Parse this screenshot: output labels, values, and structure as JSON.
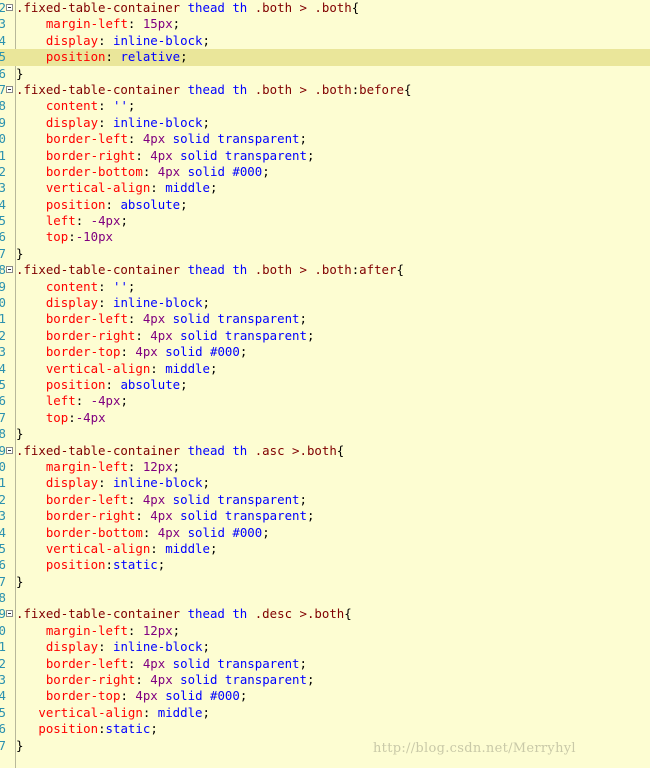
{
  "editor": {
    "lines": [
      {
        "ln": "2",
        "fold": true,
        "tokens": [
          [
            "sel",
            ".fixed-table-container "
          ],
          [
            "kw",
            "thead th"
          ],
          [
            "sel",
            " .both > .both"
          ],
          [
            "pun",
            "{"
          ]
        ]
      },
      {
        "ln": "3",
        "tokens": [
          [
            "pun",
            "    "
          ],
          [
            "prop",
            "margin-left"
          ],
          [
            "pun",
            ": "
          ],
          [
            "num",
            "15px"
          ],
          [
            "pun",
            ";"
          ]
        ]
      },
      {
        "ln": "4",
        "tokens": [
          [
            "pun",
            "    "
          ],
          [
            "prop",
            "display"
          ],
          [
            "pun",
            ": "
          ],
          [
            "val",
            "inline-block"
          ],
          [
            "pun",
            ";"
          ]
        ]
      },
      {
        "ln": "5",
        "hl": true,
        "tokens": [
          [
            "pun",
            "    "
          ],
          [
            "prop",
            "position"
          ],
          [
            "pun",
            ": "
          ],
          [
            "val",
            "relative"
          ],
          [
            "pun",
            ";"
          ]
        ]
      },
      {
        "ln": "6",
        "tokens": [
          [
            "pun",
            "}"
          ]
        ]
      },
      {
        "ln": "7",
        "fold": true,
        "tokens": [
          [
            "sel",
            ".fixed-table-container "
          ],
          [
            "kw",
            "thead th"
          ],
          [
            "sel",
            " .both > .both"
          ],
          [
            "pun",
            ":"
          ],
          [
            "sel",
            "before"
          ],
          [
            "pun",
            "{"
          ]
        ]
      },
      {
        "ln": "8",
        "tokens": [
          [
            "pun",
            "    "
          ],
          [
            "prop",
            "content"
          ],
          [
            "pun",
            ": "
          ],
          [
            "val",
            "''"
          ],
          [
            "pun",
            ";"
          ]
        ]
      },
      {
        "ln": "9",
        "tokens": [
          [
            "pun",
            "    "
          ],
          [
            "prop",
            "display"
          ],
          [
            "pun",
            ": "
          ],
          [
            "val",
            "inline-block"
          ],
          [
            "pun",
            ";"
          ]
        ]
      },
      {
        "ln": "0",
        "tokens": [
          [
            "pun",
            "    "
          ],
          [
            "prop",
            "border-left"
          ],
          [
            "pun",
            ": "
          ],
          [
            "num",
            "4px"
          ],
          [
            "val",
            " solid transparent"
          ],
          [
            "pun",
            ";"
          ]
        ]
      },
      {
        "ln": "1",
        "tokens": [
          [
            "pun",
            "    "
          ],
          [
            "prop",
            "border-right"
          ],
          [
            "pun",
            ": "
          ],
          [
            "num",
            "4px"
          ],
          [
            "val",
            " solid transparent"
          ],
          [
            "pun",
            ";"
          ]
        ]
      },
      {
        "ln": "2",
        "tokens": [
          [
            "pun",
            "    "
          ],
          [
            "prop",
            "border-bottom"
          ],
          [
            "pun",
            ": "
          ],
          [
            "num",
            "4px"
          ],
          [
            "val",
            " solid #000"
          ],
          [
            "pun",
            ";"
          ]
        ]
      },
      {
        "ln": "3",
        "tokens": [
          [
            "pun",
            "    "
          ],
          [
            "prop",
            "vertical-align"
          ],
          [
            "pun",
            ": "
          ],
          [
            "val",
            "middle"
          ],
          [
            "pun",
            ";"
          ]
        ]
      },
      {
        "ln": "4",
        "tokens": [
          [
            "pun",
            "    "
          ],
          [
            "prop",
            "position"
          ],
          [
            "pun",
            ": "
          ],
          [
            "val",
            "absolute"
          ],
          [
            "pun",
            ";"
          ]
        ]
      },
      {
        "ln": "5",
        "tokens": [
          [
            "pun",
            "    "
          ],
          [
            "prop",
            "left"
          ],
          [
            "pun",
            ": "
          ],
          [
            "num",
            "-4px"
          ],
          [
            "pun",
            ";"
          ]
        ]
      },
      {
        "ln": "6",
        "tokens": [
          [
            "pun",
            "    "
          ],
          [
            "prop",
            "top"
          ],
          [
            "pun",
            ":"
          ],
          [
            "num",
            "-10px"
          ]
        ]
      },
      {
        "ln": "7",
        "tokens": [
          [
            "pun",
            "}"
          ]
        ]
      },
      {
        "ln": "8",
        "fold": true,
        "tokens": [
          [
            "sel",
            ".fixed-table-container "
          ],
          [
            "kw",
            "thead th"
          ],
          [
            "sel",
            " .both > .both"
          ],
          [
            "pun",
            ":"
          ],
          [
            "sel",
            "after"
          ],
          [
            "pun",
            "{"
          ]
        ]
      },
      {
        "ln": "9",
        "tokens": [
          [
            "pun",
            "    "
          ],
          [
            "prop",
            "content"
          ],
          [
            "pun",
            ": "
          ],
          [
            "val",
            "''"
          ],
          [
            "pun",
            ";"
          ]
        ]
      },
      {
        "ln": "0",
        "tokens": [
          [
            "pun",
            "    "
          ],
          [
            "prop",
            "display"
          ],
          [
            "pun",
            ": "
          ],
          [
            "val",
            "inline-block"
          ],
          [
            "pun",
            ";"
          ]
        ]
      },
      {
        "ln": "1",
        "tokens": [
          [
            "pun",
            "    "
          ],
          [
            "prop",
            "border-left"
          ],
          [
            "pun",
            ": "
          ],
          [
            "num",
            "4px"
          ],
          [
            "val",
            " solid transparent"
          ],
          [
            "pun",
            ";"
          ]
        ]
      },
      {
        "ln": "2",
        "tokens": [
          [
            "pun",
            "    "
          ],
          [
            "prop",
            "border-right"
          ],
          [
            "pun",
            ": "
          ],
          [
            "num",
            "4px"
          ],
          [
            "val",
            " solid transparent"
          ],
          [
            "pun",
            ";"
          ]
        ]
      },
      {
        "ln": "3",
        "tokens": [
          [
            "pun",
            "    "
          ],
          [
            "prop",
            "border-top"
          ],
          [
            "pun",
            ": "
          ],
          [
            "num",
            "4px"
          ],
          [
            "val",
            " solid #000"
          ],
          [
            "pun",
            ";"
          ]
        ]
      },
      {
        "ln": "4",
        "tokens": [
          [
            "pun",
            "    "
          ],
          [
            "prop",
            "vertical-align"
          ],
          [
            "pun",
            ": "
          ],
          [
            "val",
            "middle"
          ],
          [
            "pun",
            ";"
          ]
        ]
      },
      {
        "ln": "5",
        "tokens": [
          [
            "pun",
            "    "
          ],
          [
            "prop",
            "position"
          ],
          [
            "pun",
            ": "
          ],
          [
            "val",
            "absolute"
          ],
          [
            "pun",
            ";"
          ]
        ]
      },
      {
        "ln": "6",
        "tokens": [
          [
            "pun",
            "    "
          ],
          [
            "prop",
            "left"
          ],
          [
            "pun",
            ": "
          ],
          [
            "num",
            "-4px"
          ],
          [
            "pun",
            ";"
          ]
        ]
      },
      {
        "ln": "7",
        "tokens": [
          [
            "pun",
            "    "
          ],
          [
            "prop",
            "top"
          ],
          [
            "pun",
            ":"
          ],
          [
            "num",
            "-4px"
          ]
        ]
      },
      {
        "ln": "8",
        "tokens": [
          [
            "pun",
            "}"
          ]
        ]
      },
      {
        "ln": "9",
        "fold": true,
        "tokens": [
          [
            "sel",
            ".fixed-table-container "
          ],
          [
            "kw",
            "thead th"
          ],
          [
            "sel",
            " .asc >.both"
          ],
          [
            "pun",
            "{"
          ]
        ]
      },
      {
        "ln": "0",
        "tokens": [
          [
            "pun",
            "    "
          ],
          [
            "prop",
            "margin-left"
          ],
          [
            "pun",
            ": "
          ],
          [
            "num",
            "12px"
          ],
          [
            "pun",
            ";"
          ]
        ]
      },
      {
        "ln": "1",
        "tokens": [
          [
            "pun",
            "    "
          ],
          [
            "prop",
            "display"
          ],
          [
            "pun",
            ": "
          ],
          [
            "val",
            "inline-block"
          ],
          [
            "pun",
            ";"
          ]
        ]
      },
      {
        "ln": "2",
        "tokens": [
          [
            "pun",
            "    "
          ],
          [
            "prop",
            "border-left"
          ],
          [
            "pun",
            ": "
          ],
          [
            "num",
            "4px"
          ],
          [
            "val",
            " solid transparent"
          ],
          [
            "pun",
            ";"
          ]
        ]
      },
      {
        "ln": "3",
        "tokens": [
          [
            "pun",
            "    "
          ],
          [
            "prop",
            "border-right"
          ],
          [
            "pun",
            ": "
          ],
          [
            "num",
            "4px"
          ],
          [
            "val",
            " solid transparent"
          ],
          [
            "pun",
            ";"
          ]
        ]
      },
      {
        "ln": "4",
        "tokens": [
          [
            "pun",
            "    "
          ],
          [
            "prop",
            "border-bottom"
          ],
          [
            "pun",
            ": "
          ],
          [
            "num",
            "4px"
          ],
          [
            "val",
            " solid #000"
          ],
          [
            "pun",
            ";"
          ]
        ]
      },
      {
        "ln": "5",
        "tokens": [
          [
            "pun",
            "    "
          ],
          [
            "prop",
            "vertical-align"
          ],
          [
            "pun",
            ": "
          ],
          [
            "val",
            "middle"
          ],
          [
            "pun",
            ";"
          ]
        ]
      },
      {
        "ln": "6",
        "tokens": [
          [
            "pun",
            "    "
          ],
          [
            "prop",
            "position"
          ],
          [
            "pun",
            ":"
          ],
          [
            "val",
            "static"
          ],
          [
            "pun",
            ";"
          ]
        ]
      },
      {
        "ln": "7",
        "tokens": [
          [
            "pun",
            "}"
          ]
        ]
      },
      {
        "ln": "8",
        "tokens": []
      },
      {
        "ln": "9",
        "fold": true,
        "tokens": [
          [
            "sel",
            ".fixed-table-container "
          ],
          [
            "kw",
            "thead th"
          ],
          [
            "sel",
            " .desc >.both"
          ],
          [
            "pun",
            "{"
          ]
        ]
      },
      {
        "ln": "0",
        "tokens": [
          [
            "pun",
            "    "
          ],
          [
            "prop",
            "margin-left"
          ],
          [
            "pun",
            ": "
          ],
          [
            "num",
            "12px"
          ],
          [
            "pun",
            ";"
          ]
        ]
      },
      {
        "ln": "1",
        "tokens": [
          [
            "pun",
            "    "
          ],
          [
            "prop",
            "display"
          ],
          [
            "pun",
            ": "
          ],
          [
            "val",
            "inline-block"
          ],
          [
            "pun",
            ";"
          ]
        ]
      },
      {
        "ln": "2",
        "tokens": [
          [
            "pun",
            "    "
          ],
          [
            "prop",
            "border-left"
          ],
          [
            "pun",
            ": "
          ],
          [
            "num",
            "4px"
          ],
          [
            "val",
            " solid transparent"
          ],
          [
            "pun",
            ";"
          ]
        ]
      },
      {
        "ln": "3",
        "tokens": [
          [
            "pun",
            "    "
          ],
          [
            "prop",
            "border-right"
          ],
          [
            "pun",
            ": "
          ],
          [
            "num",
            "4px"
          ],
          [
            "val",
            " solid transparent"
          ],
          [
            "pun",
            ";"
          ]
        ]
      },
      {
        "ln": "4",
        "tokens": [
          [
            "pun",
            "    "
          ],
          [
            "prop",
            "border-top"
          ],
          [
            "pun",
            ": "
          ],
          [
            "num",
            "4px"
          ],
          [
            "val",
            " solid #000"
          ],
          [
            "pun",
            ";"
          ]
        ]
      },
      {
        "ln": "5",
        "tokens": [
          [
            "pun",
            "   "
          ],
          [
            "prop",
            "vertical-align"
          ],
          [
            "pun",
            ": "
          ],
          [
            "val",
            "middle"
          ],
          [
            "pun",
            ";"
          ]
        ]
      },
      {
        "ln": "6",
        "tokens": [
          [
            "pun",
            "   "
          ],
          [
            "prop",
            "position"
          ],
          [
            "pun",
            ":"
          ],
          [
            "val",
            "static"
          ],
          [
            "pun",
            ";"
          ]
        ]
      },
      {
        "ln": "7",
        "tokens": [
          [
            "pun",
            "}"
          ]
        ]
      }
    ]
  },
  "watermark": "http://blog.csdn.net/Merryhyl",
  "colors": {
    "background": "#fdfdd2",
    "highlight": "#eae69a",
    "selector": "#800000",
    "keyword": "#0000ff",
    "property": "#ff0000",
    "value": "#0000ff",
    "number": "#800080",
    "line_number": "#2b91af"
  },
  "icons": {
    "fold": "collapse-box-icon"
  }
}
